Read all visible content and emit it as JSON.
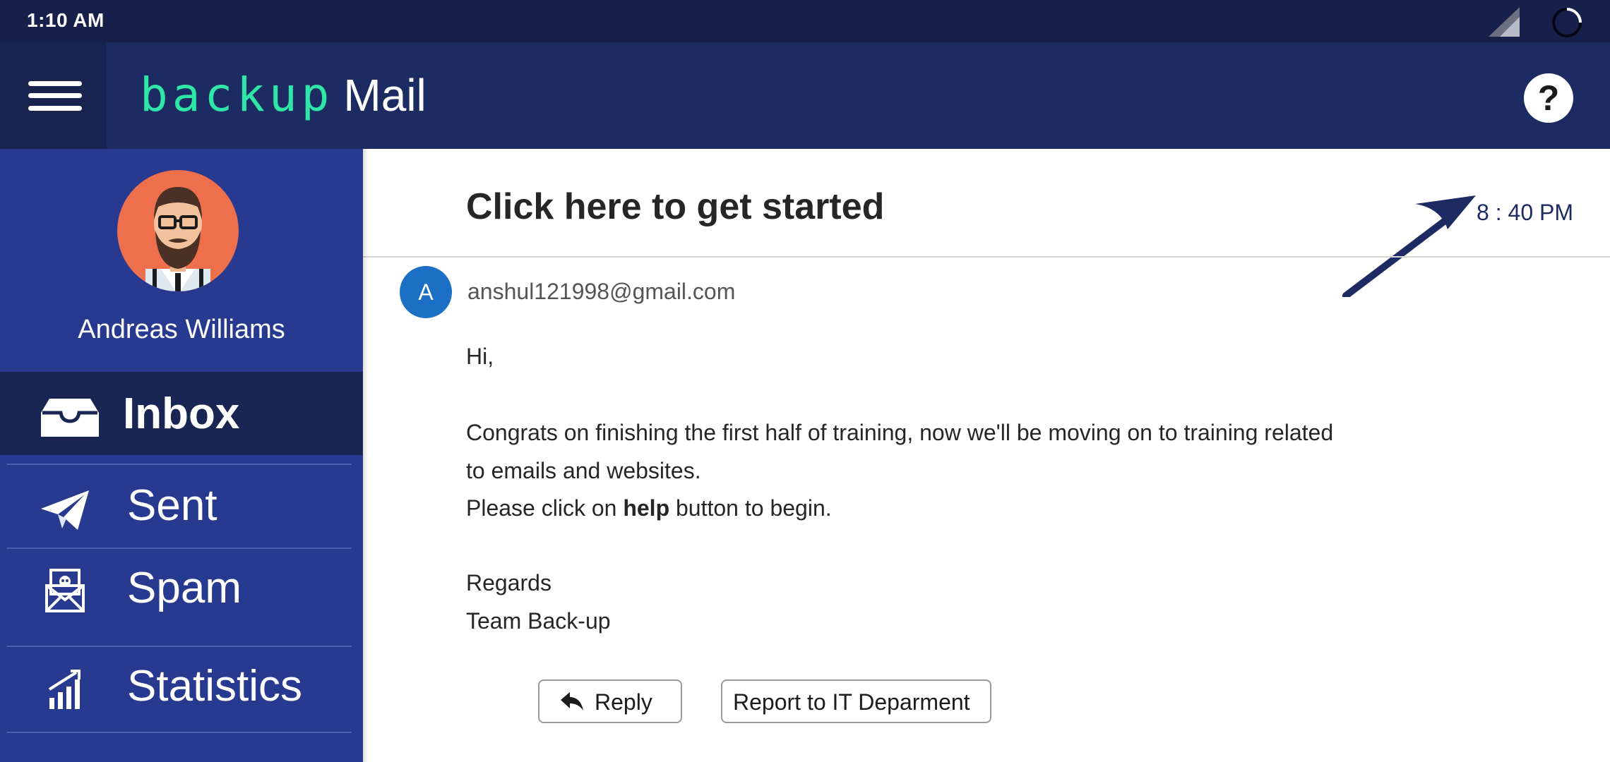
{
  "status_bar": {
    "time": "1:10 AM"
  },
  "app_bar": {
    "brand_first": "backup",
    "brand_second": "Mail",
    "help_symbol": "?"
  },
  "sidebar": {
    "user_name": "Andreas Williams",
    "items": [
      {
        "label": "Inbox",
        "icon": "inbox-icon",
        "active": true
      },
      {
        "label": "Sent",
        "icon": "paper-plane-icon",
        "active": false
      },
      {
        "label": "Spam",
        "icon": "spam-envelope-icon",
        "active": false
      },
      {
        "label": "Statistics",
        "icon": "bar-chart-icon",
        "active": false
      }
    ]
  },
  "email": {
    "subject": "Click here to get started",
    "time": "8 : 40 PM",
    "sender_initial": "A",
    "sender": "anshul121998@gmail.com",
    "greeting": "Hi,",
    "body_line1": "Congrats on finishing the first half of training, now we'll be moving on to training related",
    "body_line2": "to emails and websites.",
    "body_line3_before": "Please click on ",
    "body_line3_bold": "help",
    "body_line3_after": " button to begin.",
    "signoff": "Regards",
    "signature": "Team Back-up"
  },
  "actions": {
    "reply_label": "Reply",
    "report_label": "Report to IT Deparment"
  },
  "colors": {
    "status_bar": "#16204a",
    "app_bar": "#1d2b63",
    "sidebar": "#273a8f",
    "sidebar_active": "#192654",
    "brand_accent": "#2ee6a5",
    "sender_avatar": "#1b6fc4"
  }
}
